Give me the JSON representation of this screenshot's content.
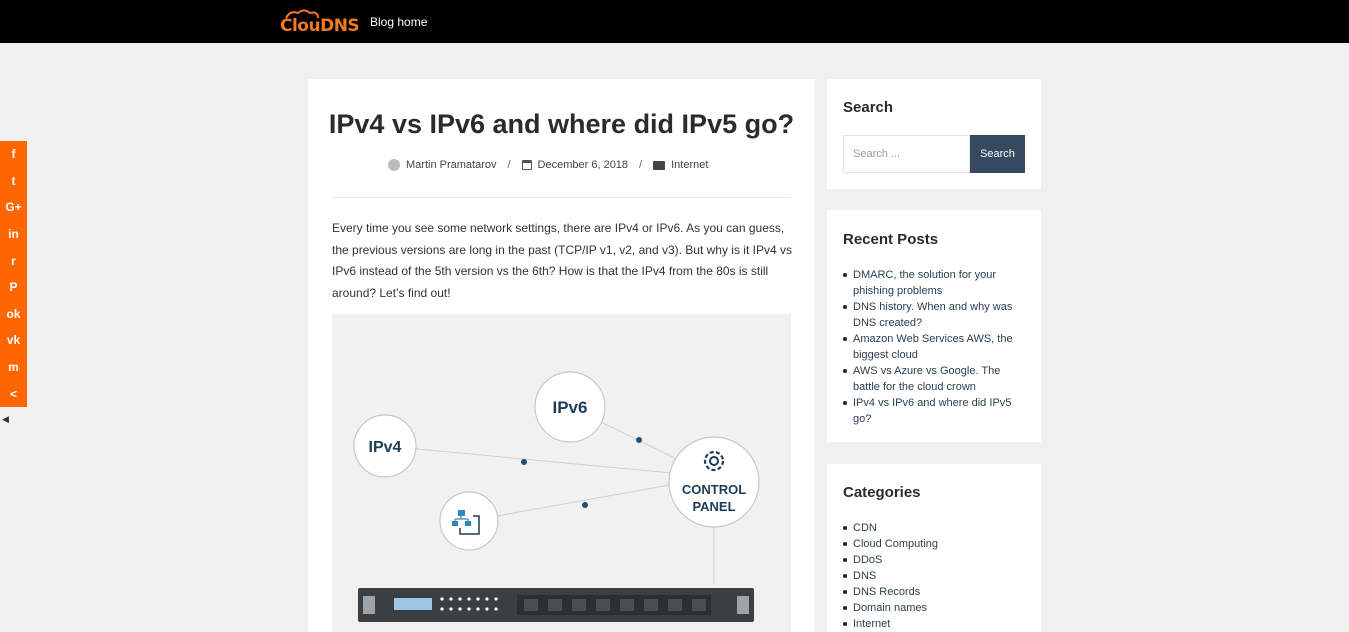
{
  "header": {
    "logo_text": "ClouDNS",
    "nav_blog_home": "Blog home"
  },
  "social_share": {
    "items": [
      {
        "name": "facebook",
        "glyph": "f"
      },
      {
        "name": "twitter",
        "glyph": "t"
      },
      {
        "name": "google-plus",
        "glyph": "G+"
      },
      {
        "name": "linkedin",
        "glyph": "in"
      },
      {
        "name": "reddit",
        "glyph": "r"
      },
      {
        "name": "pinterest",
        "glyph": "P"
      },
      {
        "name": "odnoklassniki",
        "glyph": "ok"
      },
      {
        "name": "vk",
        "glyph": "vk"
      },
      {
        "name": "mix",
        "glyph": "m"
      },
      {
        "name": "share",
        "glyph": "<"
      }
    ],
    "color": "#ff6600"
  },
  "post": {
    "title": "IPv4 vs IPv6 and where did IPv5 go?",
    "author": "Martin Pramatarov",
    "date": "December 6, 2018",
    "category": "Internet",
    "intro": "Every time you see some network settings, there are IPv4 or IPv6. As you can guess, the previous versions are long in the past (TCP/IP v1, v2, and v3). But why is it IPv4 vs IPv6 instead of the 5th version vs the 6th? How is that the IPv4 from the 80s is still around? Let’s find out!",
    "figure": {
      "node_ipv4": "IPv4",
      "node_ipv6": "IPv6",
      "node_control_line1": "CONTROL",
      "node_control_line2": "PANEL"
    }
  },
  "sidebar": {
    "search": {
      "title": "Search",
      "placeholder": "Search ...",
      "button": "Search"
    },
    "recent": {
      "title": "Recent Posts",
      "items": [
        {
          "l1": "DMARC, the solution for your",
          "l2": "phishing problems"
        },
        {
          "l1": "DNS history. When and why was",
          "l2": "DNS created?"
        },
        {
          "l1": "Amazon Web Services AWS, the",
          "l2": "biggest cloud"
        },
        {
          "l1": "AWS vs Azure vs Google. The",
          "l2": "battle for the cloud crown"
        },
        {
          "l1": "IPv4 vs IPv6 and where did IPv5",
          "l2": "go?"
        }
      ]
    },
    "categories": {
      "title": "Categories",
      "items": [
        "CDN",
        "Cloud Computing",
        "DDoS",
        "DNS",
        "DNS Records",
        "Domain names",
        "Internet"
      ]
    }
  },
  "colors": {
    "brand_orange": "#f47a1f",
    "dark_navy": "#34495e",
    "diagram_text": "#1f3b57"
  }
}
